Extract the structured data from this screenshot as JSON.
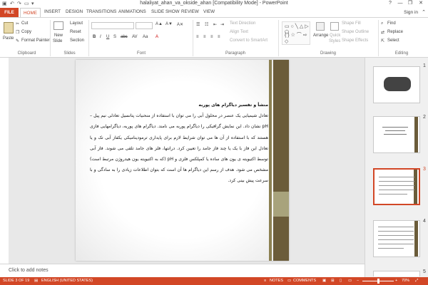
{
  "window": {
    "title": "halaliyat_ahan_va_okside_ahan [Compatibility Mode] - PowerPoint",
    "controls": [
      "?",
      "—",
      "❐",
      "✕"
    ]
  },
  "tabs": {
    "file": "FILE",
    "items": [
      "HOME",
      "INSERT",
      "DESIGN",
      "TRANSITIONS",
      "ANIMATIONS",
      "SLIDE SHOW",
      "REVIEW",
      "VIEW"
    ],
    "active": "HOME",
    "sign_in": "Sign in"
  },
  "ribbon": {
    "clipboard": {
      "paste": "Paste",
      "cut": "Cut",
      "copy": "Copy",
      "format_painter": "Format Painter",
      "label": "Clipboard"
    },
    "slides": {
      "new_slide": "New",
      "new_slide2": "Slide",
      "layout": "Layout",
      "reset": "Reset",
      "section": "Section",
      "label": "Slides"
    },
    "font": {
      "label": "Font"
    },
    "paragraph": {
      "text_direction": "Text Direction",
      "align_text": "Align Text",
      "convert_smartart": "Convert to SmartArt",
      "label": "Paragraph"
    },
    "drawing": {
      "arrange": "Arrange",
      "quick_styles": "Quick",
      "quick_styles2": "Styles",
      "shape_fill": "Shape Fill",
      "shape_outline": "Shape Outline",
      "shape_effects": "Shape Effects",
      "label": "Drawing"
    },
    "editing": {
      "find": "Find",
      "replace": "Replace",
      "select": "Select",
      "label": "Editing"
    }
  },
  "thumbnails": [
    {
      "number": "1"
    },
    {
      "number": "2"
    },
    {
      "number": "3"
    },
    {
      "number": "4"
    },
    {
      "number": "5"
    }
  ],
  "slide": {
    "heading": "منشأ و تفسیر دیاگرام های پوربه",
    "body": "تعادل شیمیایی یک عنصر در محلول آبی را می توان با استفاده از منحنیات پتانسیل تعادلی نیم پیل – pH  نشان داد. این نمایش گرافیکی را دیاگرام پوربه می نامند. دیاگرام های پوربه، دیاگرامهایی فازی هستند که با استفاده از آن ها می توان شرایط لازم برای پایداری ترمودینامیکی یکفاز آبی تک و یا تعادل این فاز با یک یا چند فاز جامد را تعیین کرد. درانتها، فلز های جامد تلقی می شوند. فاز آبی توسط اکتیویته ی یون های ساده یا کمپلکس فلزی و pH (که به اکتیویته یون هیدروژن مرتبط است) مشخص می شود. هدف از رسم این دیاگرام ها آن است که بتوان اطلاعات زیادی را به سادگی و با سرعت پیش بینی کرد."
  },
  "notes": {
    "placeholder": "Click to add notes"
  },
  "status": {
    "slide": "SLIDE 3 OF 19",
    "language": "ENGLISH (UNITED STATES)",
    "notes": "NOTES",
    "comments": "COMMENTS",
    "zoom": "70%"
  }
}
